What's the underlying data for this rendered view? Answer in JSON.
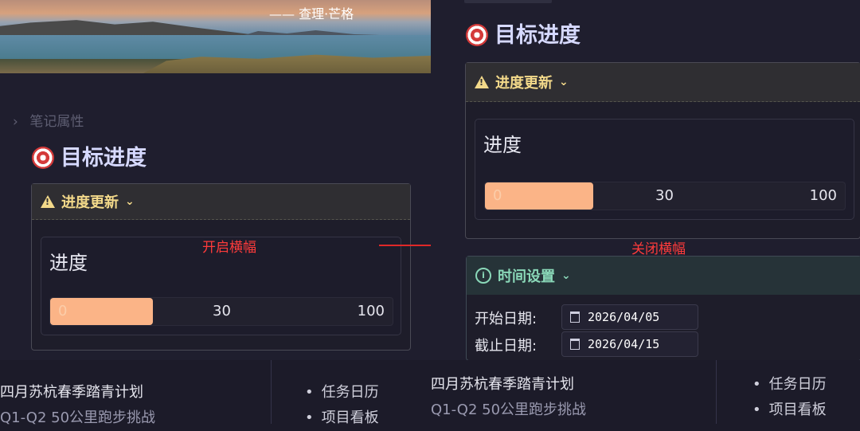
{
  "banner": {
    "quote": "—— 查理·芒格"
  },
  "left": {
    "props_label": "笔记属性",
    "title": "目标进度",
    "callout_title": "进度更新",
    "card_label": "进度",
    "progress": {
      "min": "0",
      "value": "30",
      "max": "100",
      "fraction": 0.3
    },
    "annotation": "开启横幅"
  },
  "right": {
    "title": "目标进度",
    "callout_title": "进度更新",
    "card_label": "进度",
    "progress": {
      "min": "0",
      "value": "30",
      "max": "100",
      "fraction": 0.3
    },
    "annotation": "关闭横幅",
    "time_title": "时间设置",
    "start_label": "开始日期:",
    "start_value": "2026/04/05",
    "end_label": "截止日期:",
    "end_value": "2026/04/15"
  },
  "footer": {
    "projects": [
      "四月苏杭春季踏青计划",
      "Q1-Q2 50公里跑步挑战"
    ],
    "links": [
      "任务日历",
      "项目看板"
    ]
  },
  "colors": {
    "progress_fill": "#fbb487",
    "warning": "#f3d98a",
    "info": "#8ad8b8",
    "annotation": "#ff3b3b"
  }
}
